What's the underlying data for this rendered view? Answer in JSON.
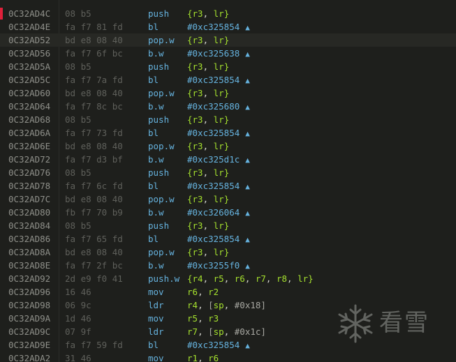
{
  "disassembly": {
    "rows": [
      {
        "addr": "0C32AD4C",
        "bytes": "08 b5",
        "mnemonic": "push",
        "operands": "{r3, lr}"
      },
      {
        "addr": "0C32AD4E",
        "bytes": "fa f7 81 fd",
        "mnemonic": "bl",
        "operands": "#0xc325854",
        "branch": true
      },
      {
        "addr": "0C32AD52",
        "bytes": "bd e8 08 40",
        "mnemonic": "pop.w",
        "operands": "{r3, lr}",
        "current": true
      },
      {
        "addr": "0C32AD56",
        "bytes": "fa f7 6f bc",
        "mnemonic": "b.w",
        "operands": "#0xc325638",
        "branch": true
      },
      {
        "addr": "0C32AD5A",
        "bytes": "08 b5",
        "mnemonic": "push",
        "operands": "{r3, lr}"
      },
      {
        "addr": "0C32AD5C",
        "bytes": "fa f7 7a fd",
        "mnemonic": "bl",
        "operands": "#0xc325854",
        "branch": true
      },
      {
        "addr": "0C32AD60",
        "bytes": "bd e8 08 40",
        "mnemonic": "pop.w",
        "operands": "{r3, lr}"
      },
      {
        "addr": "0C32AD64",
        "bytes": "fa f7 8c bc",
        "mnemonic": "b.w",
        "operands": "#0xc325680",
        "branch": true
      },
      {
        "addr": "0C32AD68",
        "bytes": "08 b5",
        "mnemonic": "push",
        "operands": "{r3, lr}"
      },
      {
        "addr": "0C32AD6A",
        "bytes": "fa f7 73 fd",
        "mnemonic": "bl",
        "operands": "#0xc325854",
        "branch": true
      },
      {
        "addr": "0C32AD6E",
        "bytes": "bd e8 08 40",
        "mnemonic": "pop.w",
        "operands": "{r3, lr}"
      },
      {
        "addr": "0C32AD72",
        "bytes": "fa f7 d3 bf",
        "mnemonic": "b.w",
        "operands": "#0xc325d1c",
        "branch": true
      },
      {
        "addr": "0C32AD76",
        "bytes": "08 b5",
        "mnemonic": "push",
        "operands": "{r3, lr}"
      },
      {
        "addr": "0C32AD78",
        "bytes": "fa f7 6c fd",
        "mnemonic": "bl",
        "operands": "#0xc325854",
        "branch": true
      },
      {
        "addr": "0C32AD7C",
        "bytes": "bd e8 08 40",
        "mnemonic": "pop.w",
        "operands": "{r3, lr}"
      },
      {
        "addr": "0C32AD80",
        "bytes": "fb f7 70 b9",
        "mnemonic": "b.w",
        "operands": "#0xc326064",
        "branch": true
      },
      {
        "addr": "0C32AD84",
        "bytes": "08 b5",
        "mnemonic": "push",
        "operands": "{r3, lr}"
      },
      {
        "addr": "0C32AD86",
        "bytes": "fa f7 65 fd",
        "mnemonic": "bl",
        "operands": "#0xc325854",
        "branch": true
      },
      {
        "addr": "0C32AD8A",
        "bytes": "bd e8 08 40",
        "mnemonic": "pop.w",
        "operands": "{r3, lr}"
      },
      {
        "addr": "0C32AD8E",
        "bytes": "fa f7 2f bc",
        "mnemonic": "b.w",
        "operands": "#0xc3255f0",
        "branch": true
      },
      {
        "addr": "0C32AD92",
        "bytes": "2d e9 f0 41",
        "mnemonic": "push.w",
        "operands": "{r4, r5, r6, r7, r8, lr}"
      },
      {
        "addr": "0C32AD96",
        "bytes": "16 46",
        "mnemonic": "mov",
        "operands": "r6, r2"
      },
      {
        "addr": "0C32AD98",
        "bytes": "06 9c",
        "mnemonic": "ldr",
        "operands": "r4, [sp, #0x18]"
      },
      {
        "addr": "0C32AD9A",
        "bytes": "1d 46",
        "mnemonic": "mov",
        "operands": "r5, r3"
      },
      {
        "addr": "0C32AD9C",
        "bytes": "07 9f",
        "mnemonic": "ldr",
        "operands": "r7, [sp, #0x1c]"
      },
      {
        "addr": "0C32AD9E",
        "bytes": "fa f7 59 fd",
        "mnemonic": "bl",
        "operands": "#0xc325854",
        "branch": true
      },
      {
        "addr": "0C32ADA2",
        "bytes": "31 46",
        "mnemonic": "mov",
        "operands": "r1, r6"
      }
    ],
    "branch_arrow": "▲"
  },
  "watermark": {
    "icon": "snowflake-icon",
    "text": "看雪"
  },
  "colors": {
    "background": "#1e1f1c",
    "address": "#8f908a",
    "bytes": "#5f605b",
    "mnemonic": "#66b3df",
    "operand_register": "#a6e22e",
    "breakpoint_marker": "#e0203a"
  }
}
